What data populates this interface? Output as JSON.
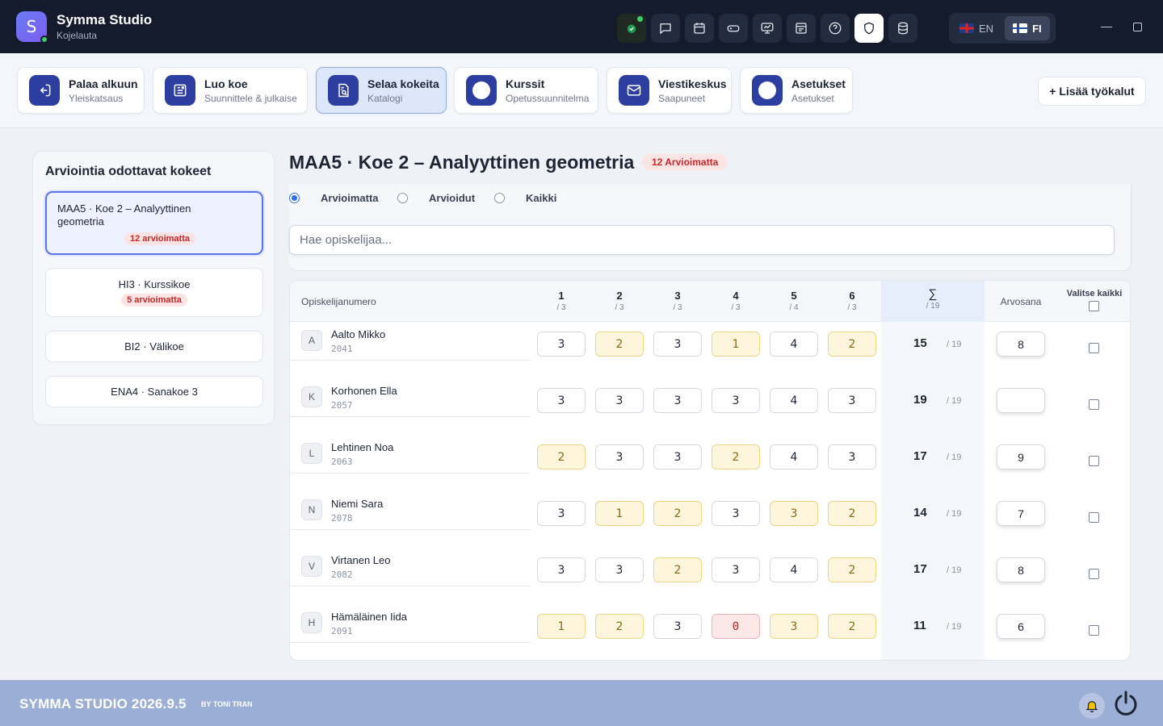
{
  "app": {
    "name": "Symma Studio",
    "subtitle": "Kojelauta",
    "logo_letter": "S"
  },
  "languages": [
    {
      "code": "EN",
      "active": false
    },
    {
      "code": "FI",
      "active": true
    }
  ],
  "tools": [
    {
      "title": "Palaa alkuun",
      "sub": "Yleiskatsaus",
      "icon": "arrow-left-circle-icon"
    },
    {
      "title": "Luo koe",
      "sub": "Suunnittele & julkaise",
      "icon": "form-icon"
    },
    {
      "title": "Selaa kokeita",
      "sub": "Katalogi",
      "icon": "document-search-icon",
      "active": true
    },
    {
      "title": "Kurssit",
      "sub": "Opetussuunnitelma",
      "icon": "circle-icon"
    },
    {
      "title": "Viestikeskus",
      "sub": "Saapuneet",
      "icon": "mail-icon"
    },
    {
      "title": "Asetukset",
      "sub": "Asetukset",
      "icon": "circle-icon"
    }
  ],
  "add_tools_label": "+ Lisää työkalut",
  "sidebar": {
    "title": "Arviointia odottavat kokeet",
    "exams": [
      {
        "name": "MAA5 · Koe 2 – Analyyttinen geometria",
        "badge": "12 arvioimatta",
        "active": true
      },
      {
        "name": "HI3 · Kurssikoe",
        "badge": "5 arvioimatta"
      },
      {
        "name": "BI2 · Välikoe",
        "badge": ""
      },
      {
        "name": "ENA4 · Sanakoe 3",
        "badge": ""
      }
    ]
  },
  "main": {
    "title": "MAA5 · Koe 2 – Analyyttinen geometria",
    "badge": "12 Arvioimatta",
    "filters": [
      "Arvioimatta",
      "Arvioidut",
      "Kaikki"
    ],
    "search_placeholder": "Hae opiskelijaa..."
  },
  "table": {
    "col_student": "Opiskelijanumero",
    "questions": [
      {
        "n": "1",
        "max": "/ 3"
      },
      {
        "n": "2",
        "max": "/ 3"
      },
      {
        "n": "3",
        "max": "/ 3"
      },
      {
        "n": "4",
        "max": "/ 3"
      },
      {
        "n": "5",
        "max": "/ 4"
      },
      {
        "n": "6",
        "max": "/ 3"
      }
    ],
    "sum_symbol": "∑",
    "sum_max": "/ 19",
    "col_grade": "Arvosana",
    "col_select": "Valitse kaikki",
    "rows": [
      {
        "initial": "A",
        "name": "Aalto Mikko",
        "id": "2041",
        "scores": [
          "3",
          "2",
          "3",
          "1",
          "4",
          "2"
        ],
        "total": "15",
        "max": "/ 19",
        "grade": "8"
      },
      {
        "initial": "K",
        "name": "Korhonen Ella",
        "id": "2057",
        "scores": [
          "3",
          "3",
          "3",
          "3",
          "4",
          "3"
        ],
        "total": "19",
        "max": "/ 19",
        "grade": ""
      },
      {
        "initial": "L",
        "name": "Lehtinen Noa",
        "id": "2063",
        "scores": [
          "2",
          "3",
          "3",
          "2",
          "4",
          "3"
        ],
        "total": "17",
        "max": "/ 19",
        "grade": "9"
      },
      {
        "initial": "N",
        "name": "Niemi Sara",
        "id": "2078",
        "scores": [
          "3",
          "1",
          "2",
          "3",
          "3",
          "2"
        ],
        "total": "14",
        "max": "/ 19",
        "grade": "7"
      },
      {
        "initial": "V",
        "name": "Virtanen Leo",
        "id": "2082",
        "scores": [
          "3",
          "3",
          "2",
          "3",
          "4",
          "2"
        ],
        "total": "17",
        "max": "/ 19",
        "grade": "8"
      },
      {
        "initial": "H",
        "name": "Hämäläinen Iida",
        "id": "2091",
        "scores": [
          "1",
          "2",
          "3",
          "0",
          "3",
          "2"
        ],
        "total": "11",
        "max": "/ 19",
        "grade": "6"
      }
    ]
  },
  "footer": {
    "title": "SYMMA STUDIO 2026.9.5",
    "by": "BY TONI TRAN"
  },
  "colors": {
    "accent": "#2c3e9f",
    "warn_bg": "#fdf5dc",
    "error_bg": "#fde8e8",
    "footer": "#9aaed6"
  }
}
